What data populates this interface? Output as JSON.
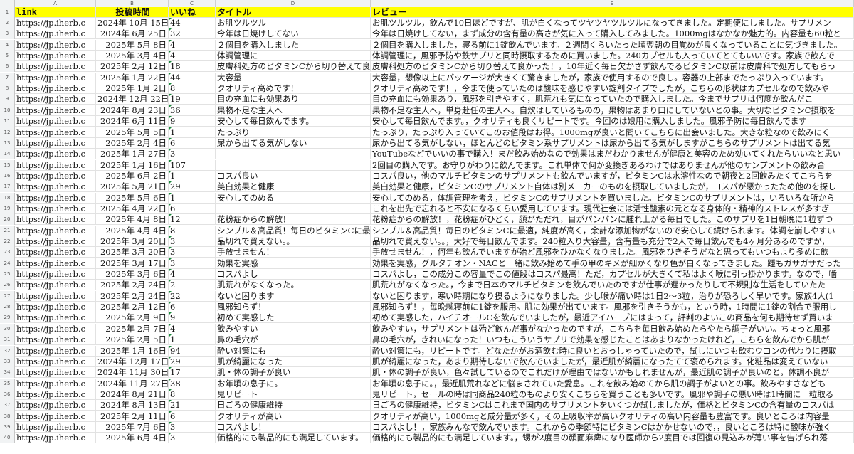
{
  "columns": [
    "A",
    "B",
    "C",
    "D",
    "E"
  ],
  "headers": {
    "link": "link",
    "date": "投稿時間",
    "likes": "いいね",
    "title": "タイトル",
    "review": "レビュー"
  },
  "rows": [
    {
      "n": "2",
      "link": "https://jp.iherb.c",
      "date": "2024年 10月 15日",
      "likes": "44",
      "title": "お肌ツルツル",
      "review": "お肌ツルツル，飲んで10日ほどですが、肌が白くなってツヤツヤツルツルになってきました。定期便にしました。サプリメン"
    },
    {
      "n": "3",
      "link": "https://jp.iherb.c",
      "date": "2024年 6月 25日",
      "likes": "32",
      "title": "今年は日焼けしてない",
      "review": "今年は日焼けしてない，まず成分の含有量の高さが気に入って購入してみました。1000mgはなかなか魅力的。内容量も60粒と"
    },
    {
      "n": "4",
      "link": "https://jp.iherb.c",
      "date": "2025年 5月 8日",
      "likes": "4",
      "title": "２個目を購入しました",
      "review": "２個目を購入しました，寝る前に1錠飲んでいます。２週間くらいたった頃翌朝の目覚めが良くなっていることに気づきました。"
    },
    {
      "n": "5",
      "link": "https://jp.iherb.c",
      "date": "2025年 3月 4日",
      "likes": "4",
      "title": "体調管理に",
      "review": "体調管理に，風邪予防や鉄サプリと同時摂取するために買いました。240カプセルも入っていてとてもいいです。家族で飲んで"
    },
    {
      "n": "6",
      "link": "https://jp.iherb.c",
      "date": "2025年 2月 12日",
      "likes": "18",
      "title": "皮膚科処方のビタミンCから切り替えて良かった",
      "review": "皮膚科処方のビタミンCから切り替えて良かった！，10年近く毎日欠かさず飲んでるビタミンC以前は皮膚科で処方してもらっ"
    },
    {
      "n": "7",
      "link": "https://jp.iherb.c",
      "date": "2025年 1月 22日",
      "likes": "44",
      "title": "大容量",
      "review": "大容量，想像以上にパッケージが大きくて驚きましたが，家族で使用するので良し。容器の上部までたっぷり入っています。"
    },
    {
      "n": "8",
      "link": "https://jp.iherb.c",
      "date": "2025年 1月 2日",
      "likes": "8",
      "title": "クオリティ高めです！",
      "review": "クオリティ高めです！，今まで使っていたのは酸味を感じやすい錠剤タイプでしたが，こちらの形状はカプセルなので飲みや"
    },
    {
      "n": "9",
      "link": "https://jp.iherb.c",
      "date": "2024年 12月 22日",
      "likes": "19",
      "title": "目の充血にも効果あり",
      "review": "目の充血にも効果あり，風邪を引きやすく，肌荒れも気になっていたので購入しました。今までサプリは何度か飲んだこ"
    },
    {
      "n": "10",
      "link": "https://jp.iherb.c",
      "date": "2024年 8月 23日",
      "likes": "36",
      "title": "果物不足な主人へ",
      "review": "果物不足な主人へ，単身赴任の主人へ。自炊はしているものの，果物はあまり口にしていないとの事。大切なビタミンC摂取を"
    },
    {
      "n": "11",
      "link": "https://jp.iherb.c",
      "date": "2024年 6月 11日",
      "likes": "9",
      "title": "安心して毎日飲んでます。",
      "review": "安心して毎日飲んでます。，クオリティも良くリピートです。今回のは娘用に購入しました。風邪予防に毎日飲んでます"
    },
    {
      "n": "12",
      "link": "https://jp.iherb.c",
      "date": "2025年 5月 5日",
      "likes": "1",
      "title": "たっぷり",
      "review": "たっぷり，たっぷり入っていてこのお値段はお得。1000mgが良いと聞いてこちらに出会いました。大きな粒なので飲みにく"
    },
    {
      "n": "13",
      "link": "https://jp.iherb.c",
      "date": "2025年 2月 4日",
      "likes": "6",
      "title": "尿から出てる気がしない",
      "review": "尿から出てる気がしない，ほとんどのビタミン系サプリメントは尿から出てる気がしますがこちらのサプリメントは出てる気"
    },
    {
      "n": "14",
      "link": "https://jp.iherb.c",
      "date": "2025年 1月 27日",
      "likes": "3",
      "title": "",
      "review": "YouTubeなどでいいの事で購入！まだ飲み始めなので効果はまだわかりませんが健康と美容のため効いてくれたらいいなと思い"
    },
    {
      "n": "15",
      "link": "https://jp.iherb.c",
      "date": "2025年 1月 16日",
      "likes": "107",
      "title": "",
      "review": "2回目の購入です。お守りがわりに飲んでます。これ単体で何か変換ぎあるわけではありませんが他のサンプメントの飲み合"
    },
    {
      "n": "16",
      "link": "https://jp.iherb.c",
      "date": "2025年 6月 2日",
      "likes": "1",
      "title": "コスパ良い",
      "review": "コスパ良い，他のマルチビタミンのサプリメントも飲んでいますが，ビタミンCは水溶性なので朝夜と2回飲みたくてこちらを"
    },
    {
      "n": "17",
      "link": "https://jp.iherb.c",
      "date": "2025年 5月 21日",
      "likes": "29",
      "title": "美白効果と健康",
      "review": "美白効果と健康，ビタミンCのサプリメント自体は別メーカーのものを摂取していましたが，コスパが悪かったため他のを探し"
    },
    {
      "n": "18",
      "link": "https://jp.iherb.c",
      "date": "2025年 5月 6日",
      "likes": "1",
      "title": "安心してのめる",
      "review": "安心してのめる，体調管理を考え，ビタミンCのサプリメントを買いました。ビタミンCのサプリメントは，いろいろな所から"
    },
    {
      "n": "19",
      "link": "https://jp.iherb.c",
      "date": "2025年 4月 22日",
      "likes": "6",
      "title": "",
      "review": "これを出先で忘れると不安になるくらい愛用しています。現代社会には活性酸素の元となる身体的・精神的ストレスが多すぎ"
    },
    {
      "n": "20",
      "link": "https://jp.iherb.c",
      "date": "2025年 4月 8日",
      "likes": "12",
      "title": "花粉症からの解放！",
      "review": "花粉症からの解放！，花粉症がひどく，顔がただれ，目がパンパンに腫れ上がる毎日でした。このサプリを1日朝晩に1粒ずつ"
    },
    {
      "n": "21",
      "link": "https://jp.iherb.c",
      "date": "2025年 4月 4日",
      "likes": "8",
      "title": "シンプル＆高品質！毎日のビタミンCに最適",
      "review": "シンプル＆高品質！毎日のビタミンCに最適，純度が高く，余計な添加物がないので安心して続けられます。体調を崩しやすい"
    },
    {
      "n": "22",
      "link": "https://jp.iherb.c",
      "date": "2025年 3月 20日",
      "likes": "3",
      "title": "品切れで買えない。。",
      "review": "品切れで買えない。。，大好で毎日飲んでます。240粒入り大容量，含有量も充分で2人で毎日飲んでも4ヶ月分あるのですが，"
    },
    {
      "n": "23",
      "link": "https://jp.iherb.c",
      "date": "2025年 3月 20日",
      "likes": "3",
      "title": "手放せません！",
      "review": "手放せません！，何年も飲んでいますが殆ど風邪をひかなくなりました。風邪をひきそうだなと思ってもいつもより多めに飲"
    },
    {
      "n": "24",
      "link": "https://jp.iherb.c",
      "date": "2025年 3月 17日",
      "likes": "3",
      "title": "効果を実感",
      "review": "効果を実感，グルタチオン・NACと一緒に飲み始めて手の甲のキメが細かくなり色が白くなってきました。踵もガサガサだった"
    },
    {
      "n": "25",
      "link": "https://jp.iherb.c",
      "date": "2025年 3月 6日",
      "likes": "4",
      "title": "コスパよし",
      "review": "コスパよし，この成分この容量でこの値段はコスパ最高！ただ，カプセルが大きくて私はよく喉に引っ掛かります。なので，噛"
    },
    {
      "n": "26",
      "link": "https://jp.iherb.c",
      "date": "2025年 2月 24日",
      "likes": "2",
      "title": "肌荒れがなくなった。",
      "review": "肌荒れがなくなった。，今まで日本のマルチビタミンを飲んでいたのですが仕事が遅かったりして不規則な生活をしていたた"
    },
    {
      "n": "27",
      "link": "https://jp.iherb.c",
      "date": "2025年 2月 24日",
      "likes": "22",
      "title": "ないと困ります",
      "review": "ないと困ります，寒い時期になり摂るようになりました。少し喉が痛い時は1日2〜3粒，治りが恐ろしく早いです。家族4人(1"
    },
    {
      "n": "28",
      "link": "https://jp.iherb.c",
      "date": "2025年 2月 12日",
      "likes": "6",
      "title": "風邪知らず！",
      "review": "風邪知らず！，毎晩就寝前に1錠を服用。肌に効果が出ています。風邪を引きそうかも，という時，1時間に1錠の割合で服用し"
    },
    {
      "n": "29",
      "link": "https://jp.iherb.c",
      "date": "2025年 2月 9日",
      "likes": "9",
      "title": "初めて実感した",
      "review": "初めて実感した，ハイチオールCを飲んでいましたが，最近アイハーブにはまって，評判のよいこの商品を何も期待せず買いま"
    },
    {
      "n": "30",
      "link": "https://jp.iherb.c",
      "date": "2025年 2月 7日",
      "likes": "4",
      "title": "飲みやすい",
      "review": "飲みやすい，サプリメントは殆ど飲んだ事がなかったのですが，こちらを毎日飲み始めたらやたら調子がいい。ちょっと風邪"
    },
    {
      "n": "31",
      "link": "https://jp.iherb.c",
      "date": "2025年 2月 5日",
      "likes": "1",
      "title": "鼻の毛穴が",
      "review": "鼻の毛穴が，きれいになった！いつもこういうサプリで効果を感じたことはあまりなかったけれど，こちらを飲んでから肌が"
    },
    {
      "n": "32",
      "link": "https://jp.iherb.c",
      "date": "2025年 1月 16日",
      "likes": "94",
      "title": "酔い対策にも",
      "review": "酔い対策にも，リピートです。どなたかがお酒飲む時に良いとおっしゃっていたので，試しにいつも飲むウコンの代わりに摂取"
    },
    {
      "n": "33",
      "link": "https://jp.iherb.c",
      "date": "2024年 12月 17日",
      "likes": "29",
      "title": "肌が綺麗になった",
      "review": "肌が綺麗になった，あまり期待しないで飲んでいましたが，最近肌が綺麗になったてて褒められます。化粧品は変えていない"
    },
    {
      "n": "34",
      "link": "https://jp.iherb.c",
      "date": "2024年 11月 30日",
      "likes": "17",
      "title": "肌・体の調子が良い",
      "review": "肌・体の調子が良い，色々試しているのでこれだけが理由ではないかもしれませんが，最近肌の調子が良いのと，体調不良が"
    },
    {
      "n": "35",
      "link": "https://jp.iherb.c",
      "date": "2024年 11月 27日",
      "likes": "38",
      "title": "お年頃の息子に。",
      "review": "お年頃の息子に。，最近肌荒れなどに悩まされていた愛息。これを飲み始めてから肌の調子がよいとの事。飲みやすさなども"
    },
    {
      "n": "36",
      "link": "https://jp.iherb.c",
      "date": "2024年 8月 21日",
      "likes": "8",
      "title": "鬼リピート",
      "review": "鬼リピート，セールの時は同商品240粒のものより安くこちらを買うことも多いです。風邪や調子の悪い時は1時間に一粒取る"
    },
    {
      "n": "37",
      "link": "https://jp.iherb.c",
      "date": "2024年 8月 13日",
      "likes": "21",
      "title": "日ごろの健康維持",
      "review": "日ごろの健康維持，ビタミンCはこれまで国内のサプリメントをいくつか試しましたが，価格とビタミンCの含有量のコスパは"
    },
    {
      "n": "38",
      "link": "https://jp.iherb.c",
      "date": "2025年 2月 11日",
      "likes": "6",
      "title": "クオリティが高い",
      "review": "クオリティが高い，1000mgと成分量が多く，その上吸収率が高いクオリティの高い内容量も豊富です。良いところは内容量"
    },
    {
      "n": "39",
      "link": "https://jp.iherb.c",
      "date": "2025年 7月 6日",
      "likes": "3",
      "title": "コスパよし！",
      "review": "コスパよし！，家族みんなで飲んでいます。これからの季節特にビタミンCはかかせないので，，良いところは特に酸味が強く"
    },
    {
      "n": "40",
      "link": "https://jp.iherb.c",
      "date": "2025年 6月 4日",
      "likes": "3",
      "title": "価格的にも製品的にも満足しています。",
      "review": "価格的にも製品的にも満足しています。，甥が2度目の顔面麻痺になり医師から2度目では回復の見込みが薄い事を告げられ落"
    }
  ]
}
